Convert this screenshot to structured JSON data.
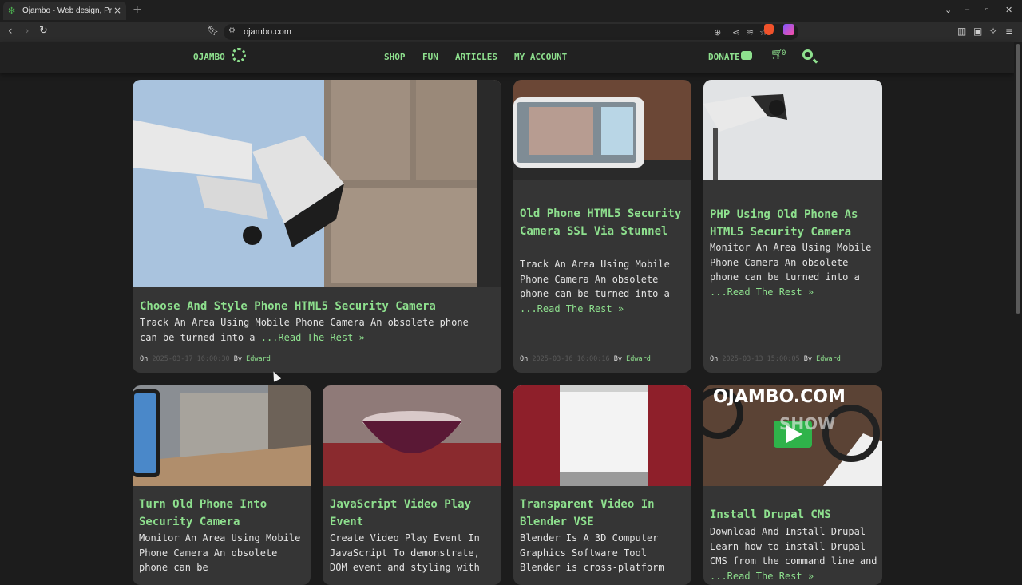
{
  "browser": {
    "tab_title": "Ojambo - Web design, Programming",
    "url": "ojambo.com",
    "new_tab": "+",
    "close": "×"
  },
  "site": {
    "logo": "OJAMBO",
    "nav": [
      "SHOP",
      "FUN",
      "ARTICLES",
      "MY ACCOUNT"
    ],
    "donate": "DONATE",
    "cart_count": "0"
  },
  "posts": [
    {
      "title": "Choose And Style Phone HTML5 Security Camera",
      "excerpt": "Track An Area Using Mobile Phone Camera An obsolete phone can be turned into a ",
      "read_more": "...Read The Rest »",
      "date": "2025-03-17 16:00:30",
      "author": "Edward"
    },
    {
      "title": "Old Phone HTML5 Security Camera SSL Via Stunnel",
      "excerpt": "Track An Area Using Mobile Phone Camera An obsolete phone can be turned into a ",
      "read_more": "...Read The Rest »",
      "date": "2025-03-16 16:00:16",
      "author": "Edward"
    },
    {
      "title": "PHP Using Old Phone As HTML5 Security Camera",
      "excerpt": "Monitor An Area Using Mobile Phone Camera An obsolete phone can be turned into a ",
      "read_more": "...Read The Rest »",
      "date": "2025-03-13 15:00:05",
      "author": "Edward"
    },
    {
      "title": "Turn Old Phone Into Security Camera",
      "excerpt": "Monitor An Area Using Mobile Phone Camera An obsolete phone can be"
    },
    {
      "title": "JavaScript Video Play Event",
      "excerpt": "Create Video Play Event In JavaScript To demonstrate, DOM event and styling with"
    },
    {
      "title": "Transparent Video In Blender VSE",
      "excerpt": "Blender Is A 3D Computer Graphics Software Tool Blender is cross-platform"
    },
    {
      "title": "Install Drupal CMS",
      "excerpt": "Download And Install Drupal Learn how to install Drupal CMS from the command line and ",
      "read_more": "...Read The Rest »",
      "thumb_text": "OJAMBO.COM",
      "thumb_text2": "SHOW"
    }
  ],
  "meta_labels": {
    "on": "On",
    "by": "By"
  }
}
